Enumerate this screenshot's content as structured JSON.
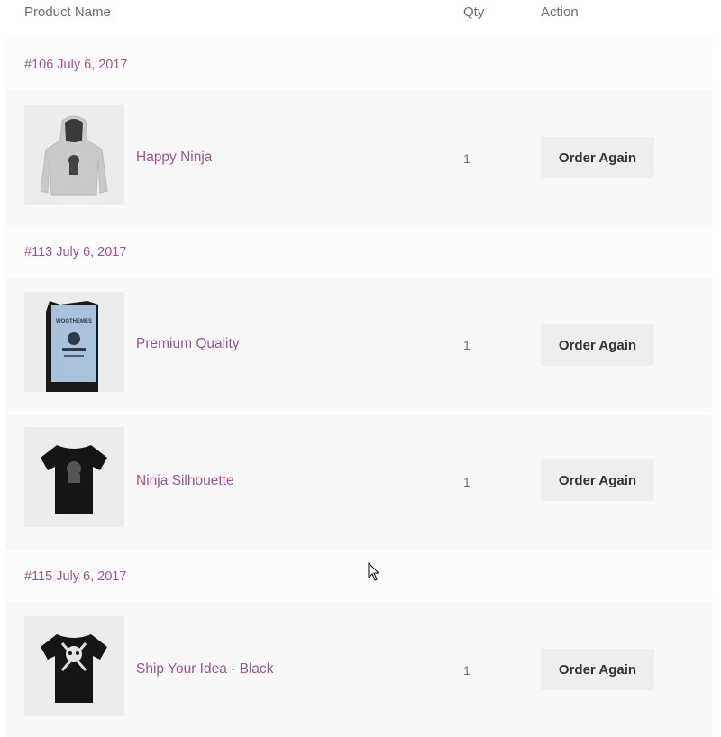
{
  "header": {
    "product_name": "Product Name",
    "qty": "Qty",
    "action": "Action"
  },
  "orders": [
    {
      "label": "#106 July 6, 2017",
      "items": [
        {
          "name": "Happy Ninja",
          "qty": "1",
          "button": "Order Again",
          "thumb_icon": "hoodie-icon"
        }
      ]
    },
    {
      "label": "#113 July 6, 2017",
      "items": [
        {
          "name": "Premium Quality",
          "qty": "1",
          "button": "Order Again",
          "thumb_icon": "poster-icon"
        },
        {
          "name": "Ninja Silhouette",
          "qty": "1",
          "button": "Order Again",
          "thumb_icon": "tshirt-icon"
        }
      ]
    },
    {
      "label": "#115 July 6, 2017",
      "items": [
        {
          "name": "Ship Your Idea - Black",
          "qty": "1",
          "button": "Order Again",
          "thumb_icon": "skull-tshirt-icon"
        }
      ]
    }
  ],
  "colors": {
    "link": "#96588a",
    "button_bg": "#eeeeee",
    "row_bg": "#f8f8f8"
  }
}
